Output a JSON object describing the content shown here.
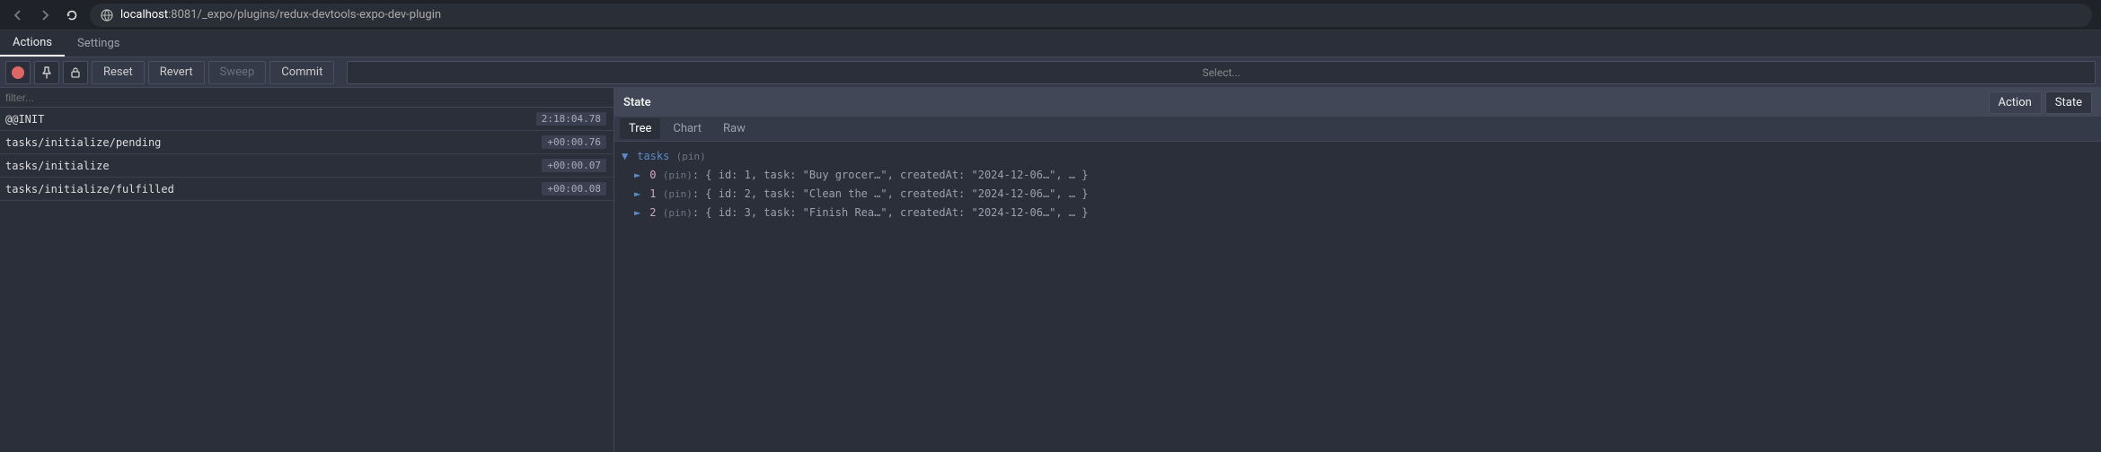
{
  "browser": {
    "url_host": "localhost",
    "url_port": ":8081",
    "url_path": "/_expo/plugins/redux-devtools-expo-dev-plugin"
  },
  "tabs": {
    "actions": "Actions",
    "settings": "Settings"
  },
  "toolbar": {
    "reset": "Reset",
    "revert": "Revert",
    "sweep": "Sweep",
    "commit": "Commit",
    "select_placeholder": "Select..."
  },
  "filter_placeholder": "filter...",
  "actions": [
    {
      "label": "@@INIT",
      "time": "2:18:04.78"
    },
    {
      "label": "tasks/initialize/pending",
      "time": "+00:00.76"
    },
    {
      "label": "tasks/initialize",
      "time": "+00:00.07"
    },
    {
      "label": "tasks/initialize/fulfilled",
      "time": "+00:00.08"
    }
  ],
  "right": {
    "title": "State",
    "btn_action": "Action",
    "btn_state": "State",
    "subtabs": {
      "tree": "Tree",
      "chart": "Chart",
      "raw": "Raw"
    }
  },
  "state": {
    "root_key": "tasks",
    "pin_label": "(pin)",
    "items": [
      {
        "idx": "0",
        "summary": "{ id: 1, task: \"Buy grocer…\", createdAt: \"2024-12-06…\", … }"
      },
      {
        "idx": "1",
        "summary": "{ id: 2, task: \"Clean the …\", createdAt: \"2024-12-06…\", … }"
      },
      {
        "idx": "2",
        "summary": "{ id: 3, task: \"Finish Rea…\", createdAt: \"2024-12-06…\", … }"
      }
    ]
  }
}
